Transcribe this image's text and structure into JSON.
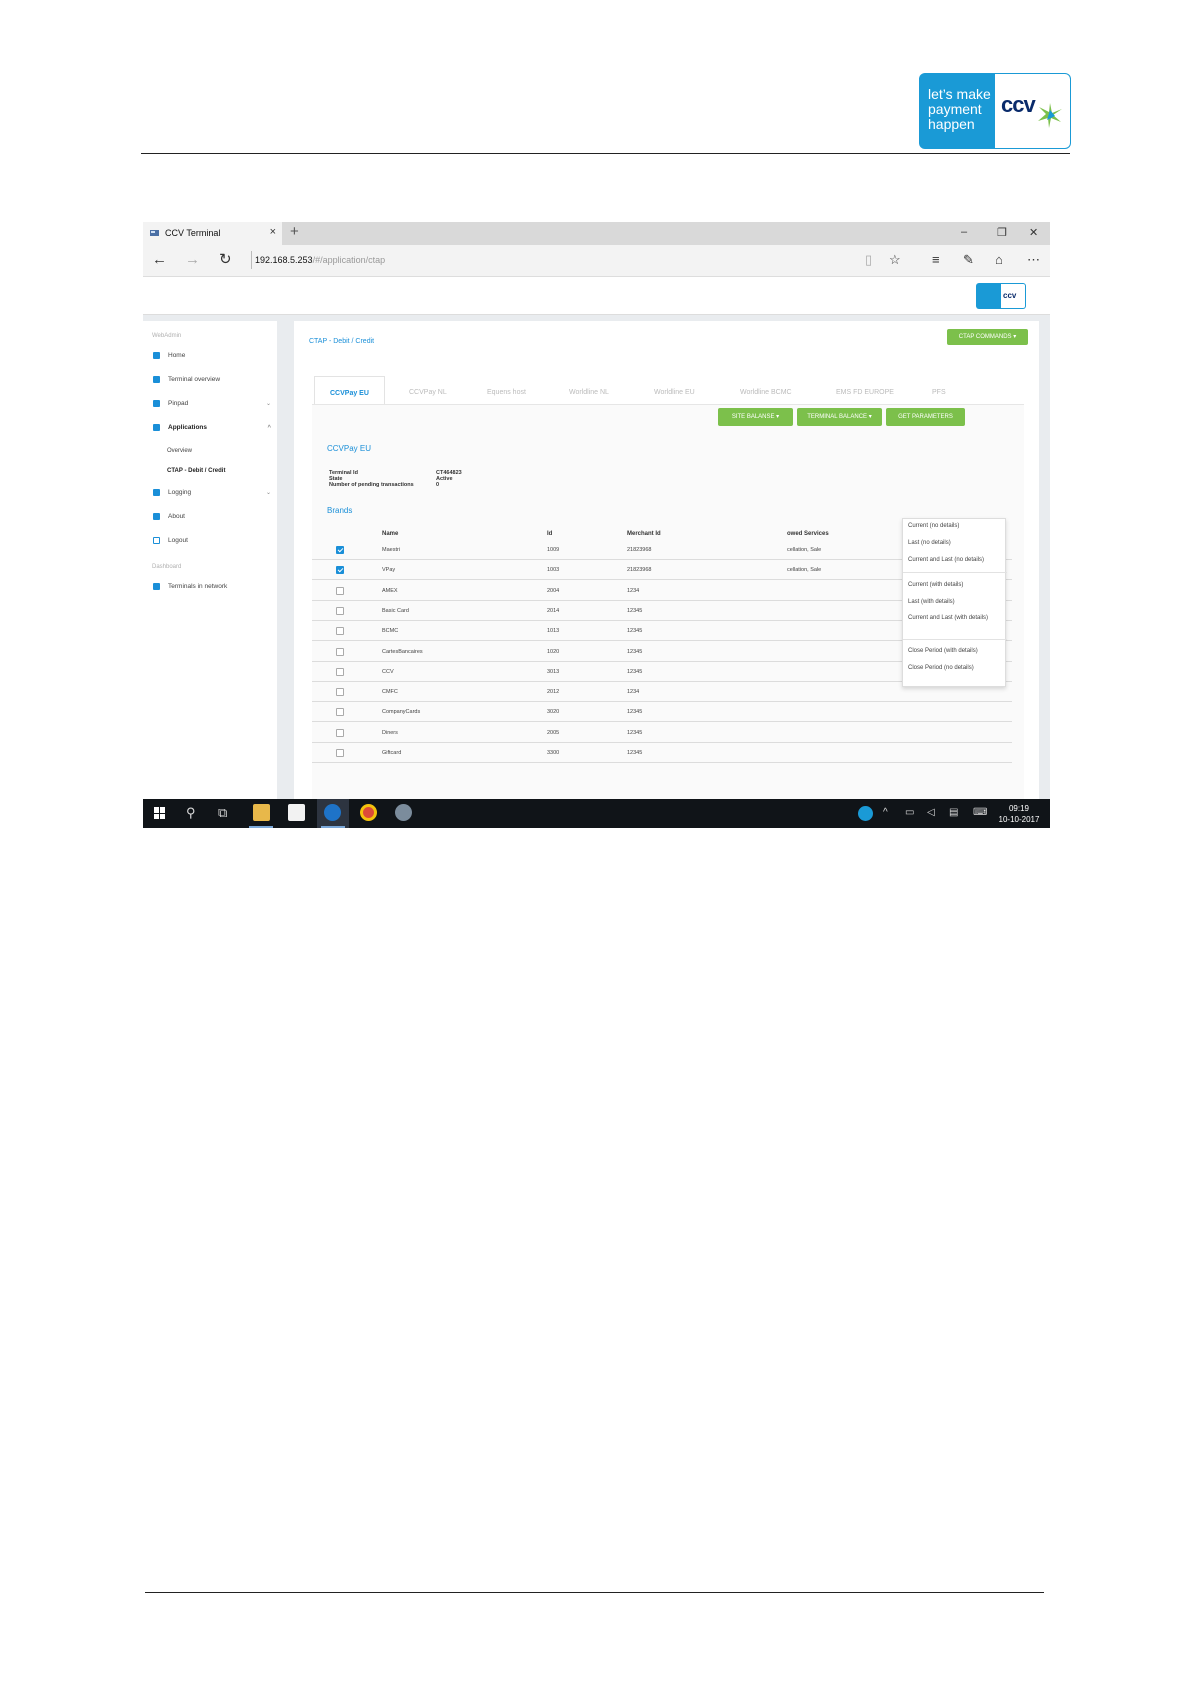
{
  "document": {
    "logo": {
      "tagline": [
        "let’s make",
        "payment",
        "happen"
      ],
      "brand": "ccv"
    }
  },
  "browser": {
    "tab_title": "CCV Terminal",
    "tab_close": "×",
    "new_tab": "+",
    "url_host": "192.168.5.253",
    "url_path": "/#/application/ctap",
    "window_controls": [
      "–",
      "❐",
      "✕"
    ]
  },
  "app": {
    "mini_logo": "ccv",
    "sidebar": {
      "section_webadmin": "WebAdmin",
      "items": [
        {
          "label": "Home"
        },
        {
          "label": "Terminal overview"
        },
        {
          "label": "Pinpad",
          "chevron": "⌄"
        },
        {
          "label": "Applications",
          "chevron": "^"
        },
        {
          "label": "Logging",
          "chevron": "⌄"
        },
        {
          "label": "About"
        },
        {
          "label": "Logout"
        }
      ],
      "sub_items": [
        "Overview",
        "CTAP - Debit / Credit"
      ],
      "section_dashboard": "Dashboard",
      "dashboard_items": [
        "Terminals in network"
      ]
    },
    "breadcrumb": "CTAP - Debit / Credit",
    "ctap_commands": "CTAP COMMANDS ▾",
    "tabs": [
      "CCVPay EU",
      "CCVPay NL",
      "Equens host",
      "Worldline NL",
      "Worldline EU",
      "Worldline BCMC",
      "EMS FD EUROPE",
      "PFS"
    ],
    "action_buttons": [
      "SITE BALANSE ▾",
      "TERMINAL BALANCE ▾",
      "GET PARAMETERS"
    ],
    "panel_title": "CCVPay EU",
    "terminal_info": {
      "labels": [
        "Terminal Id",
        "State",
        "Number of pending transactions"
      ],
      "values": [
        "CT464823",
        "Active",
        "0"
      ]
    },
    "brands_title": "Brands",
    "table": {
      "headers": [
        "Name",
        "Id",
        "Merchant Id",
        "owed Services"
      ],
      "rows": [
        {
          "checked": true,
          "name": "Maestri",
          "id": "1009",
          "merchant": "21823968",
          "services": "cellation, Sale"
        },
        {
          "checked": true,
          "name": "VPay",
          "id": "1003",
          "merchant": "21823968",
          "services": "cellation, Sale"
        },
        {
          "checked": false,
          "name": "AMEX",
          "id": "2004",
          "merchant": "1234",
          "services": ""
        },
        {
          "checked": false,
          "name": "Basic Card",
          "id": "2014",
          "merchant": "12345",
          "services": ""
        },
        {
          "checked": false,
          "name": "BCMC",
          "id": "1013",
          "merchant": "12345",
          "services": ""
        },
        {
          "checked": false,
          "name": "CartesBancaires",
          "id": "1020",
          "merchant": "12345",
          "services": ""
        },
        {
          "checked": false,
          "name": "CCV",
          "id": "3013",
          "merchant": "12345",
          "services": ""
        },
        {
          "checked": false,
          "name": "CMFC",
          "id": "2012",
          "merchant": "1234",
          "services": ""
        },
        {
          "checked": false,
          "name": "CompanyCards",
          "id": "3020",
          "merchant": "12345",
          "services": ""
        },
        {
          "checked": false,
          "name": "Diners",
          "id": "2005",
          "merchant": "12345",
          "services": ""
        },
        {
          "checked": false,
          "name": "Giftcard",
          "id": "3300",
          "merchant": "12345",
          "services": ""
        }
      ]
    },
    "dropdown": {
      "group1": [
        "Current (no details)",
        "Last (no details)",
        "Current and Last (no details)"
      ],
      "group2": [
        "Current (with details)",
        "Last (with details)",
        "Current and Last (with details)"
      ],
      "group3": [
        "Close Period (with details)",
        "Close Period (no details)"
      ]
    }
  },
  "taskbar": {
    "time": "09:19",
    "date": "10-10-2017"
  },
  "colors": {
    "brand_blue": "#1a9ad6",
    "brand_navy": "#0a2b6b",
    "button_green": "#7cc04b",
    "link_blue": "#1a8fd8"
  }
}
